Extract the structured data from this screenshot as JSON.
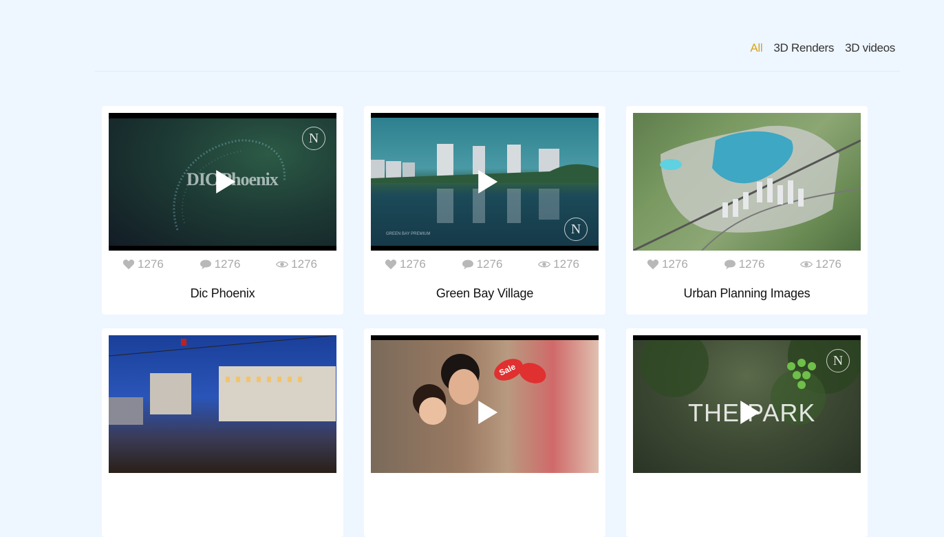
{
  "filters": {
    "all": "All",
    "renders": "3D Renders",
    "videos": "3D videos"
  },
  "cards": [
    {
      "title": "Dic Phoenix",
      "likes": "1276",
      "comments": "1276",
      "views": "1276",
      "overlay_text": "DIC Phoenix"
    },
    {
      "title": "Green Bay Village",
      "likes": "1276",
      "comments": "1276",
      "views": "1276",
      "overlay_text": "GREEN BAY PREMIUM"
    },
    {
      "title": "Urban Planning Images",
      "likes": "1276",
      "comments": "1276",
      "views": "1276"
    },
    {
      "title": "",
      "likes": "",
      "comments": "",
      "views": ""
    },
    {
      "title": "",
      "likes": "",
      "comments": "",
      "views": "",
      "overlay_text": "Sale"
    },
    {
      "title": "",
      "likes": "",
      "comments": "",
      "views": "",
      "overlay_text": "THE PARK"
    }
  ],
  "logo_letter": "N"
}
